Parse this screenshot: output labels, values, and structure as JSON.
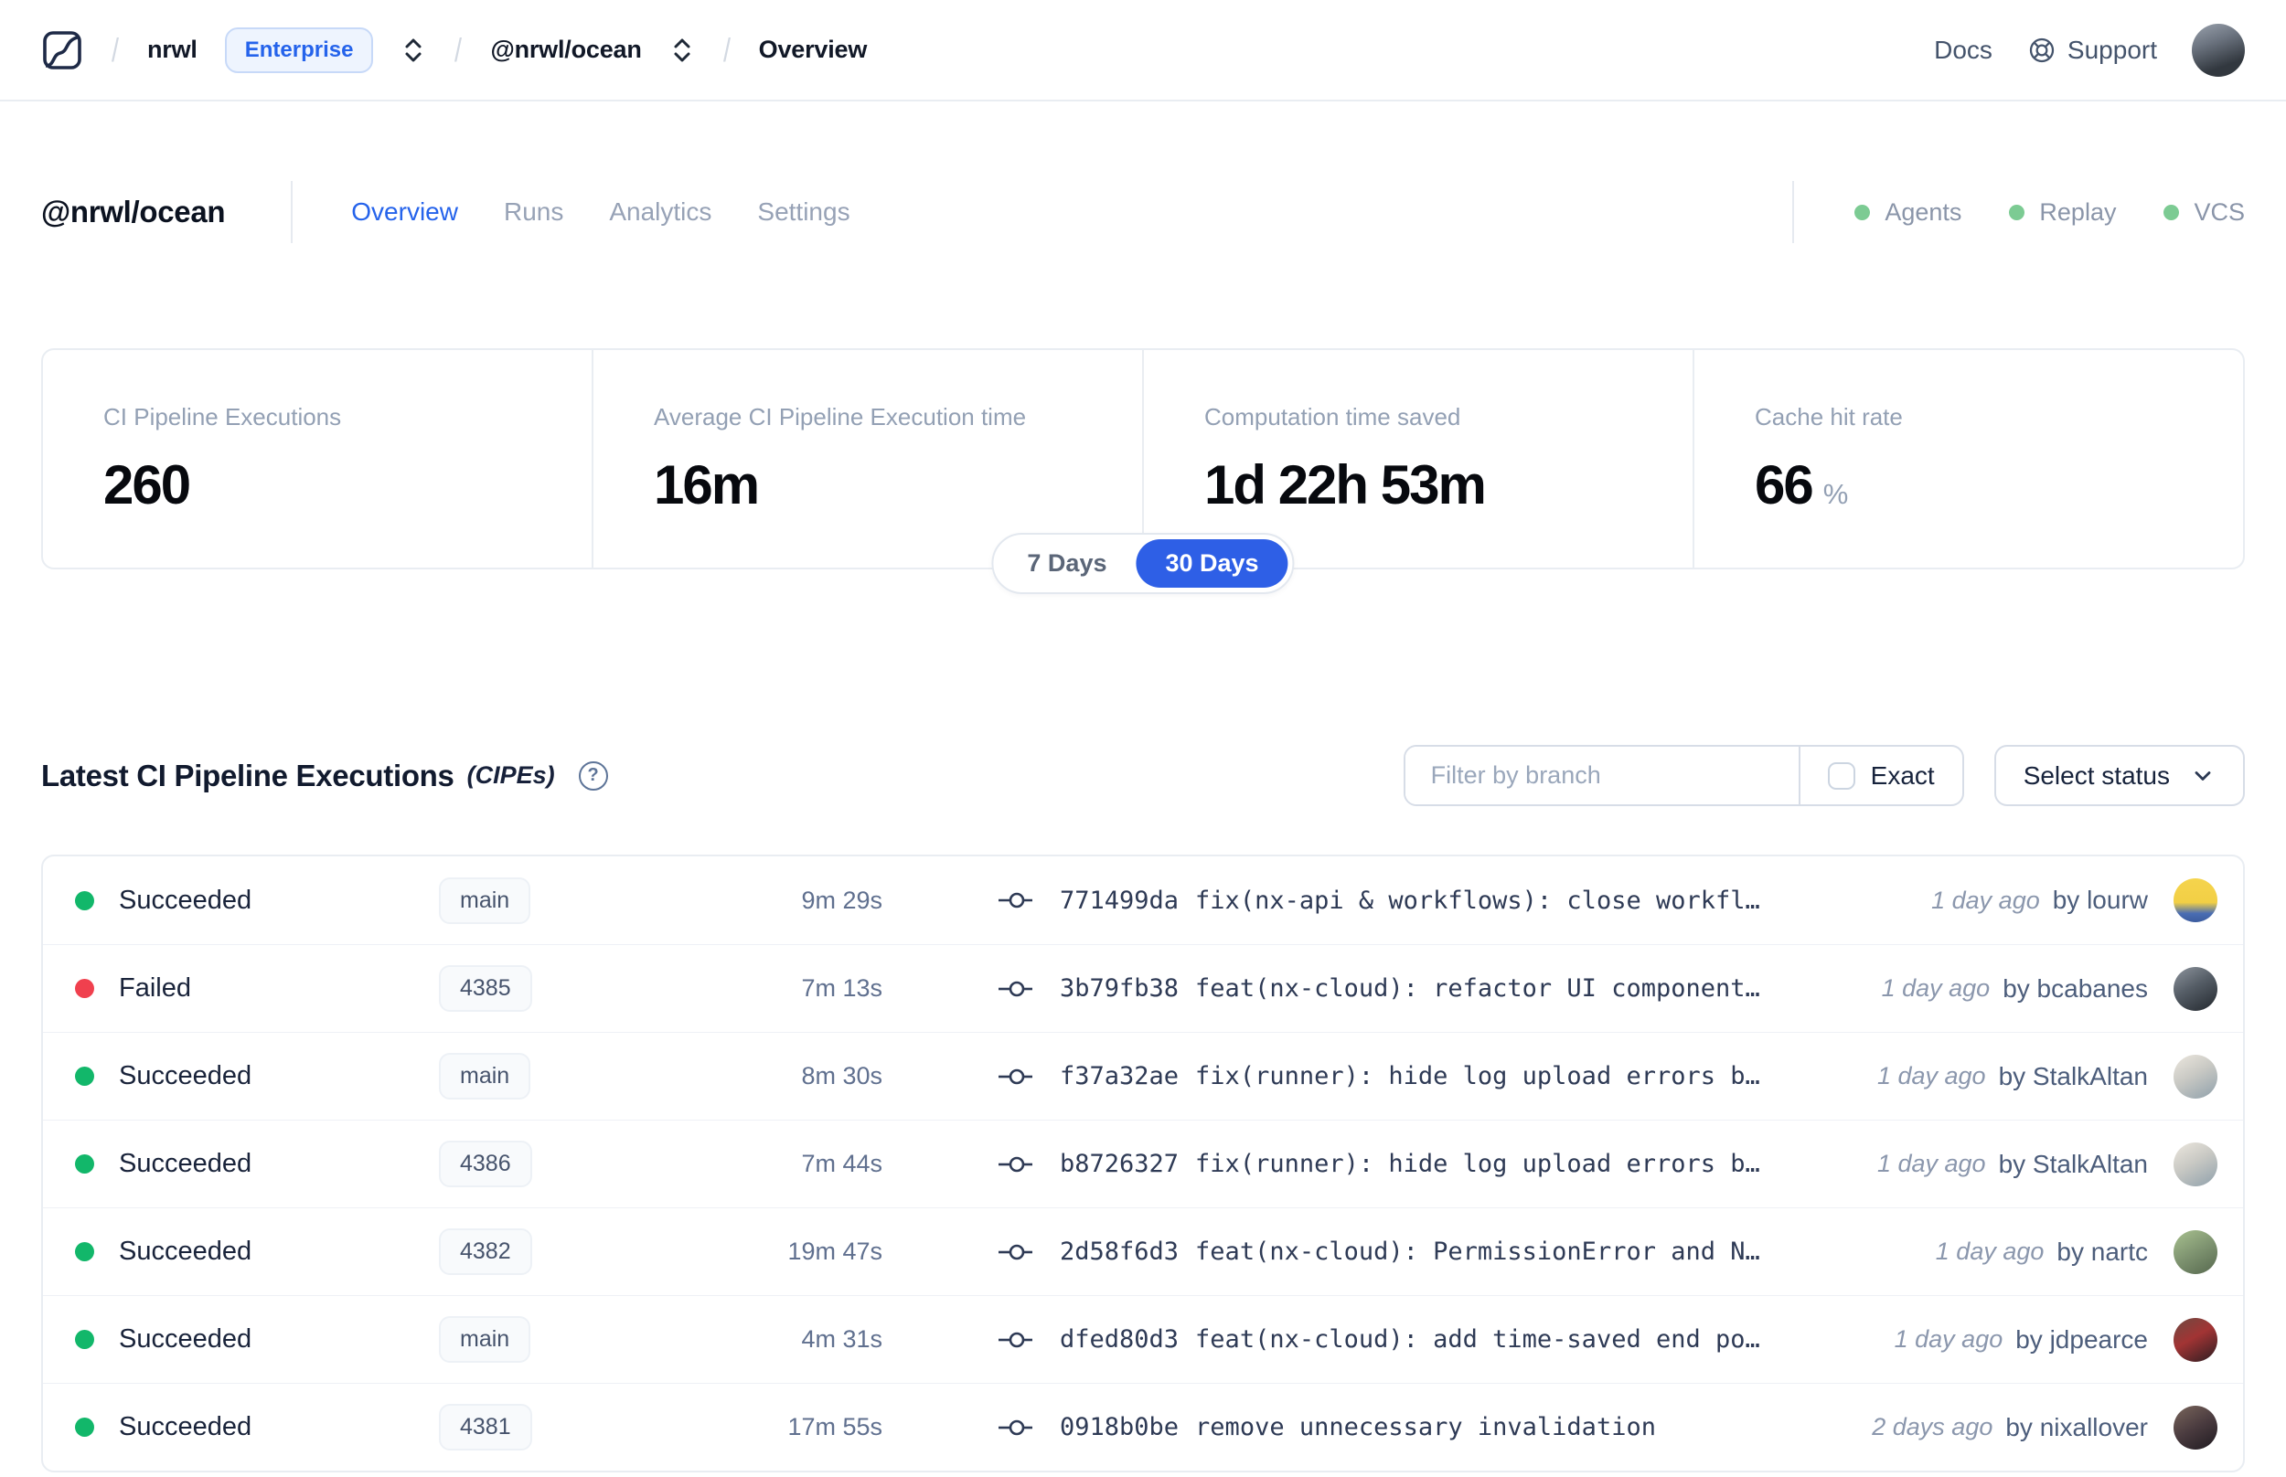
{
  "topbar": {
    "org": "nrwl",
    "org_badge": "Enterprise",
    "workspace": "@nrwl/ocean",
    "page": "Overview",
    "docs_label": "Docs",
    "support_label": "Support"
  },
  "workspace_header": {
    "title": "@nrwl/ocean",
    "tabs": [
      {
        "label": "Overview"
      },
      {
        "label": "Runs"
      },
      {
        "label": "Analytics"
      },
      {
        "label": "Settings"
      }
    ],
    "indicators": [
      {
        "label": "Agents"
      },
      {
        "label": "Replay"
      },
      {
        "label": "VCS"
      }
    ]
  },
  "stats": {
    "cards": [
      {
        "label": "CI Pipeline Executions",
        "value": "260"
      },
      {
        "label": "Average CI Pipeline Execution time",
        "value": "16m"
      },
      {
        "label": "Computation time saved",
        "value": "1d 22h 53m"
      },
      {
        "label": "Cache hit rate",
        "value": "66",
        "suffix": "%"
      }
    ],
    "range_toggle": {
      "options": [
        "7 Days",
        "30 Days"
      ],
      "selected": "30 Days"
    }
  },
  "cipe_section": {
    "title": "Latest CI Pipeline Executions",
    "title_suffix": "(CIPEs)",
    "filter_placeholder": "Filter by branch",
    "exact_label": "Exact",
    "status_dropdown_label": "Select status",
    "rows": [
      {
        "status": "Succeeded",
        "branch": "main",
        "duration": "9m 29s",
        "commit_hash": "771499da",
        "commit_message": "fix(nx-api & workflows): close workfl…",
        "time_ago": "1 day ago",
        "author": "by lourw"
      },
      {
        "status": "Failed",
        "branch": "4385",
        "duration": "7m 13s",
        "commit_hash": "3b79fb38",
        "commit_message": "feat(nx-cloud): refactor UI component…",
        "time_ago": "1 day ago",
        "author": "by bcabanes"
      },
      {
        "status": "Succeeded",
        "branch": "main",
        "duration": "8m 30s",
        "commit_hash": "f37a32ae",
        "commit_message": "fix(runner): hide log upload errors b…",
        "time_ago": "1 day ago",
        "author": "by StalkAltan"
      },
      {
        "status": "Succeeded",
        "branch": "4386",
        "duration": "7m 44s",
        "commit_hash": "b8726327",
        "commit_message": "fix(runner): hide log upload errors b…",
        "time_ago": "1 day ago",
        "author": "by StalkAltan"
      },
      {
        "status": "Succeeded",
        "branch": "4382",
        "duration": "19m 47s",
        "commit_hash": "2d58f6d3",
        "commit_message": "feat(nx-cloud): PermissionError and N…",
        "time_ago": "1 day ago",
        "author": "by nartc"
      },
      {
        "status": "Succeeded",
        "branch": "main",
        "duration": "4m 31s",
        "commit_hash": "dfed80d3",
        "commit_message": "feat(nx-cloud): add time-saved end po…",
        "time_ago": "1 day ago",
        "author": "by jdpearce"
      },
      {
        "status": "Succeeded",
        "branch": "4381",
        "duration": "17m 55s",
        "commit_hash": "0918b0be",
        "commit_message": "remove unnecessary invalidation",
        "time_ago": "2 days ago",
        "author": "by nixallover"
      }
    ]
  },
  "colors": {
    "accent_blue": "#2563eb",
    "toggle_blue": "#2e5fe6",
    "success_green": "#12b76a",
    "failed_red": "#f0404e",
    "indicator_green": "#7ccb93"
  }
}
